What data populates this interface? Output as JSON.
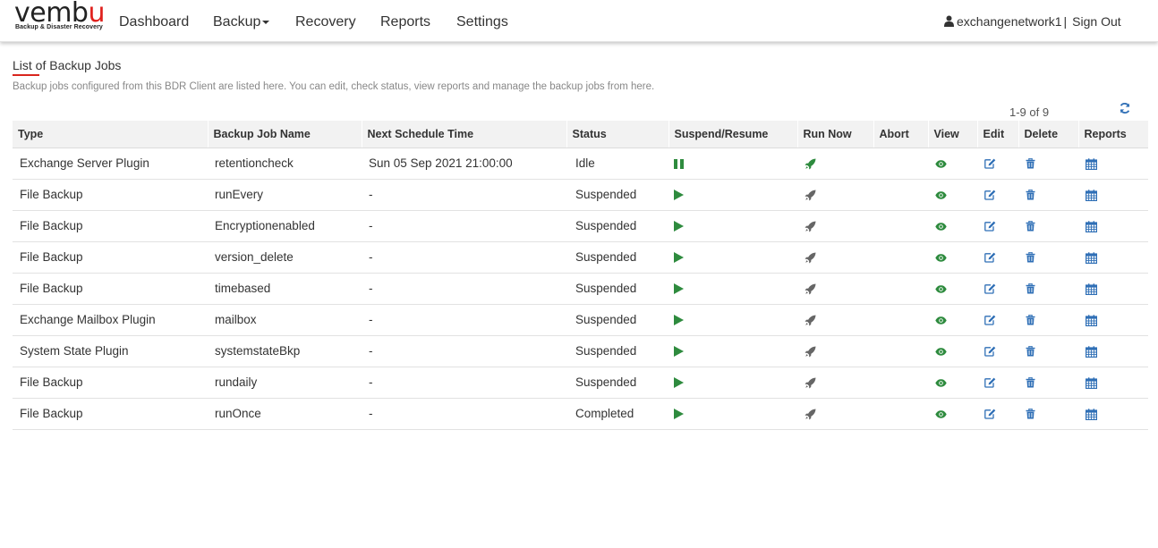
{
  "brand": {
    "name_main": "vemb",
    "name_accent": "u",
    "tagline": "Backup & Disaster Recovery"
  },
  "nav": {
    "dashboard": "Dashboard",
    "backup": "Backup",
    "recovery": "Recovery",
    "reports": "Reports",
    "settings": "Settings"
  },
  "user": {
    "name": "exchangenetwork1",
    "separator": "|",
    "sign_out": "Sign Out",
    "icon": "user-icon"
  },
  "page": {
    "title": "List of Backup Jobs",
    "description": "Backup jobs configured from this BDR Client are listed here. You can edit, check status, view reports and manage the backup jobs from here.",
    "pager": "1-9 of 9",
    "refresh_icon": "refresh-icon"
  },
  "colors": {
    "accent_red": "#d9251d",
    "green": "#2e8b3e",
    "icon_blue": "#2f6fb6",
    "gray_icon": "#666666"
  },
  "table": {
    "headers": [
      "Type",
      "Backup Job Name",
      "Next Schedule Time",
      "Status",
      "Suspend/Resume",
      "Run Now",
      "Abort",
      "View",
      "Edit",
      "Delete",
      "Reports"
    ],
    "rows": [
      {
        "type": "Exchange Server Plugin",
        "name": "retentioncheck",
        "next": "Sun 05 Sep 2021 21:00:00",
        "status": "Idle",
        "action": "pause",
        "run_active": true
      },
      {
        "type": "File Backup",
        "name": "runEvery",
        "next": "-",
        "status": "Suspended",
        "action": "play",
        "run_active": false
      },
      {
        "type": "File Backup",
        "name": "Encryptionenabled",
        "next": "-",
        "status": "Suspended",
        "action": "play",
        "run_active": false
      },
      {
        "type": "File Backup",
        "name": "version_delete",
        "next": "-",
        "status": "Suspended",
        "action": "play",
        "run_active": false
      },
      {
        "type": "File Backup",
        "name": "timebased",
        "next": "-",
        "status": "Suspended",
        "action": "play",
        "run_active": false
      },
      {
        "type": "Exchange Mailbox Plugin",
        "name": "mailbox",
        "next": "-",
        "status": "Suspended",
        "action": "play",
        "run_active": false
      },
      {
        "type": "System State Plugin",
        "name": "systemstateBkp",
        "next": "-",
        "status": "Suspended",
        "action": "play",
        "run_active": false
      },
      {
        "type": "File Backup",
        "name": "rundaily",
        "next": "-",
        "status": "Suspended",
        "action": "play",
        "run_active": false
      },
      {
        "type": "File Backup",
        "name": "runOnce",
        "next": "-",
        "status": "Completed",
        "action": "play",
        "run_active": false
      }
    ]
  }
}
